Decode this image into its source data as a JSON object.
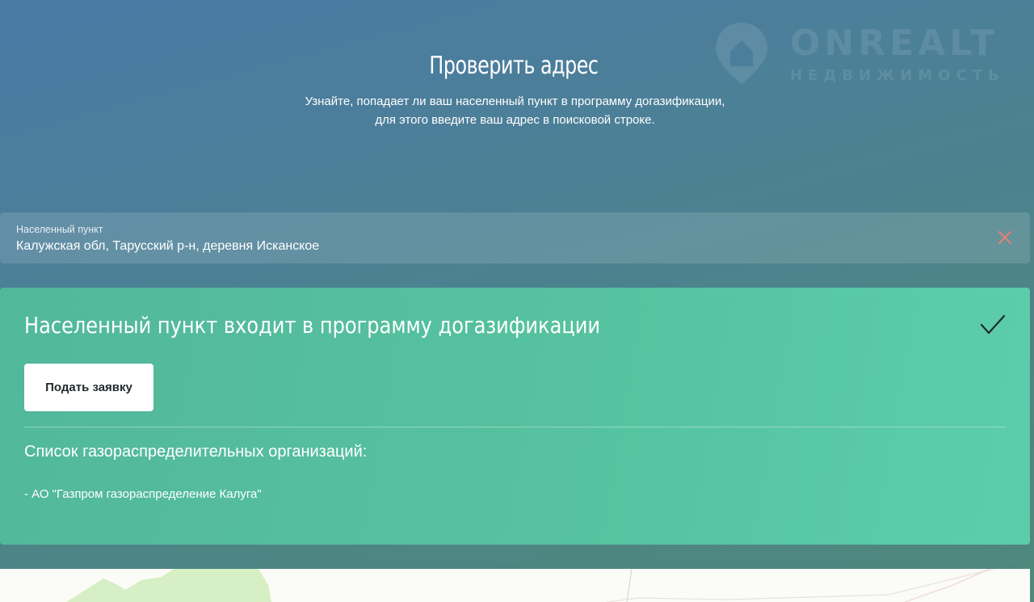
{
  "watermark": {
    "brand": "ONREALT",
    "tagline": "НЕДВИЖИМОСТЬ",
    "icon": "house-pin-icon"
  },
  "header": {
    "title": "Проверить адрес",
    "subtitle_line1": "Узнайте, попадает ли ваш населенный пункт в программу догазификации,",
    "subtitle_line2": "для этого введите ваш адрес в поисковой строке."
  },
  "address_field": {
    "label": "Населенный пункт",
    "value": "Калужская обл, Тарусский р-н, деревня Исканское",
    "clear_icon": "close-icon",
    "clear_color": "#e2807a"
  },
  "result": {
    "title": "Населенный пункт входит в программу догазификации",
    "status_icon": "check-icon",
    "apply_label": "Подать заявку",
    "orgs_heading": "Список газораспределительных организаций:",
    "orgs": [
      "- АО \"Газпром газораспределение Калуга\""
    ]
  },
  "colors": {
    "background_top": "#4a7aa6",
    "background_bottom": "#4e887c",
    "card_green": "#56c29f",
    "map_green": "#d6efc4"
  }
}
